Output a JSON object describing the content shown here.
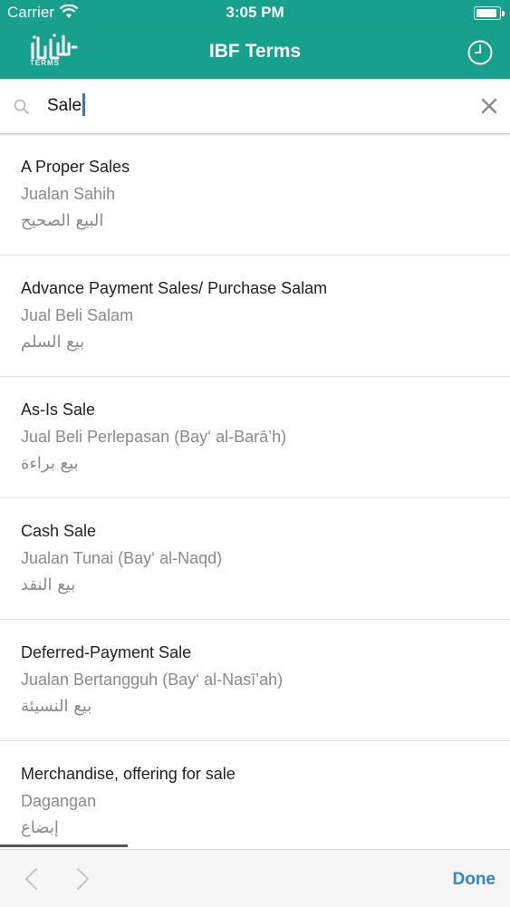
{
  "status_bar": {
    "carrier": "Carrier",
    "time": "3:05 PM"
  },
  "nav": {
    "logo_text": "TERMS",
    "title": "IBF Terms",
    "history_icon": "clock-icon"
  },
  "search": {
    "value": "Sale",
    "search_icon": "magnifier-icon",
    "clear_icon": "close-icon"
  },
  "results": [
    {
      "en": "A Proper Sales",
      "ms": "Jualan Sahih",
      "ar": "البيع الصحيح"
    },
    {
      "en": "Advance Payment Sales/ Purchase Salam",
      "ms": "Jual Beli Salam",
      "ar": "بيع السلم"
    },
    {
      "en": "As-Is Sale",
      "ms": "Jual Beli Perlepasan (Bay‘ al-Barā’h)",
      "ar": "بيع براءة"
    },
    {
      "en": "Cash Sale",
      "ms": "Jualan Tunai (Bay‘ al-Naqd)",
      "ar": "بيع النقد"
    },
    {
      "en": "Deferred-Payment Sale",
      "ms": "Jualan Bertangguh (Bay‘ al-Nasī’ah)",
      "ar": "بيع النسيئة"
    },
    {
      "en": "Merchandise, offering for sale",
      "ms": "Dagangan",
      "ar": "إبضاع"
    }
  ],
  "toolbar": {
    "prev_icon": "chevron-left-icon",
    "next_icon": "chevron-right-icon",
    "done_label": "Done"
  },
  "colors": {
    "brand": "#17a08b",
    "done": "#2f86d6"
  }
}
